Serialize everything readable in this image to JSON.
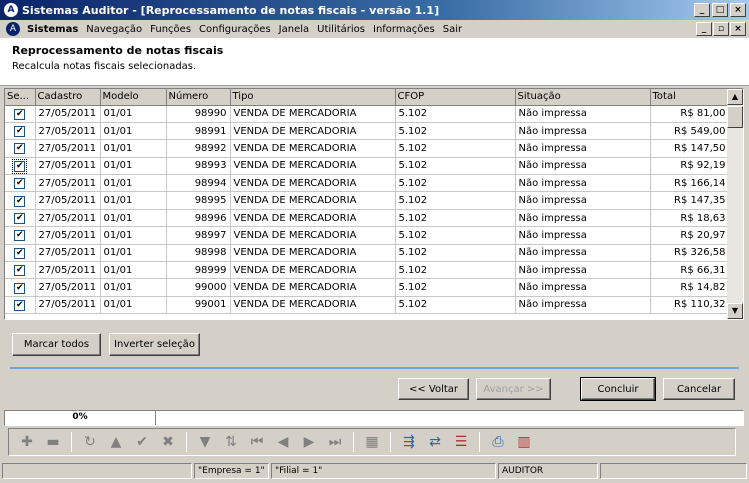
{
  "window": {
    "title": "Sistemas Auditor - [Reprocessamento de notas fiscais - versão 1.1]",
    "logo": "A"
  },
  "menu": {
    "items": [
      "Sistemas",
      "Navegação",
      "Funções",
      "Configurações",
      "Janela",
      "Utilitários",
      "Informações",
      "Sair"
    ]
  },
  "header": {
    "title": "Reprocessamento de notas fiscais",
    "subtitle": "Recalcula notas fiscais selecionadas."
  },
  "grid": {
    "columns": [
      "Se...",
      "Cadastro",
      "Modelo",
      "Número",
      "Tipo",
      "CFOP",
      "Situação",
      "Total"
    ],
    "rows": [
      {
        "checked": "✔",
        "cadastro": "27/05/2011",
        "modelo": "01/01",
        "numero": "98990",
        "tipo": "VENDA DE MERCADORIA",
        "cfop": "5.102",
        "situacao": "Não impressa",
        "total": "R$ 81,00"
      },
      {
        "checked": "✔",
        "cadastro": "27/05/2011",
        "modelo": "01/01",
        "numero": "98991",
        "tipo": "VENDA DE MERCADORIA",
        "cfop": "5.102",
        "situacao": "Não impressa",
        "total": "R$ 549,00"
      },
      {
        "checked": "✔",
        "cadastro": "27/05/2011",
        "modelo": "01/01",
        "numero": "98992",
        "tipo": "VENDA DE MERCADORIA",
        "cfop": "5.102",
        "situacao": "Não impressa",
        "total": "R$ 147,50"
      },
      {
        "checked": "✔",
        "cadastro": "27/05/2011",
        "modelo": "01/01",
        "numero": "98993",
        "tipo": "VENDA DE MERCADORIA",
        "cfop": "5.102",
        "situacao": "Não impressa",
        "total": "R$ 92,19"
      },
      {
        "checked": "✔",
        "cadastro": "27/05/2011",
        "modelo": "01/01",
        "numero": "98994",
        "tipo": "VENDA DE MERCADORIA",
        "cfop": "5.102",
        "situacao": "Não impressa",
        "total": "R$ 166,14"
      },
      {
        "checked": "✔",
        "cadastro": "27/05/2011",
        "modelo": "01/01",
        "numero": "98995",
        "tipo": "VENDA DE MERCADORIA",
        "cfop": "5.102",
        "situacao": "Não impressa",
        "total": "R$ 147,35"
      },
      {
        "checked": "✔",
        "cadastro": "27/05/2011",
        "modelo": "01/01",
        "numero": "98996",
        "tipo": "VENDA DE MERCADORIA",
        "cfop": "5.102",
        "situacao": "Não impressa",
        "total": "R$ 18,63"
      },
      {
        "checked": "✔",
        "cadastro": "27/05/2011",
        "modelo": "01/01",
        "numero": "98997",
        "tipo": "VENDA DE MERCADORIA",
        "cfop": "5.102",
        "situacao": "Não impressa",
        "total": "R$ 20,97"
      },
      {
        "checked": "✔",
        "cadastro": "27/05/2011",
        "modelo": "01/01",
        "numero": "98998",
        "tipo": "VENDA DE MERCADORIA",
        "cfop": "5.102",
        "situacao": "Não impressa",
        "total": "R$ 326,58"
      },
      {
        "checked": "✔",
        "cadastro": "27/05/2011",
        "modelo": "01/01",
        "numero": "98999",
        "tipo": "VENDA DE MERCADORIA",
        "cfop": "5.102",
        "situacao": "Não impressa",
        "total": "R$ 66,31"
      },
      {
        "checked": "✔",
        "cadastro": "27/05/2011",
        "modelo": "01/01",
        "numero": "99000",
        "tipo": "VENDA DE MERCADORIA",
        "cfop": "5.102",
        "situacao": "Não impressa",
        "total": "R$ 14,82"
      },
      {
        "checked": "✔",
        "cadastro": "27/05/2011",
        "modelo": "01/01",
        "numero": "99001",
        "tipo": "VENDA DE MERCADORIA",
        "cfop": "5.102",
        "situacao": "Não impressa",
        "total": "R$ 110,32"
      }
    ]
  },
  "actions": {
    "mark_all": "Marcar todos",
    "invert": "Inverter seleção",
    "back": "<< Voltar",
    "next": "Avançar >>",
    "finish": "Concluir",
    "cancel": "Cancelar"
  },
  "progress": {
    "label": "0%",
    "value": 0
  },
  "toolbar": {
    "icons": [
      "add-icon",
      "remove-icon",
      "refresh-icon",
      "up-icon",
      "confirm-icon",
      "cancel-icon",
      "filter-icon",
      "sort-icon",
      "first-icon",
      "prev-icon",
      "next-icon",
      "last-icon",
      "calculator-icon",
      "export-icon",
      "import-icon",
      "report-icon",
      "print-icon",
      "chart-icon"
    ]
  },
  "status": {
    "empresa": "\"Empresa = 1\"",
    "filial": "\"Filial = 1\"",
    "user": "AUDITOR"
  }
}
